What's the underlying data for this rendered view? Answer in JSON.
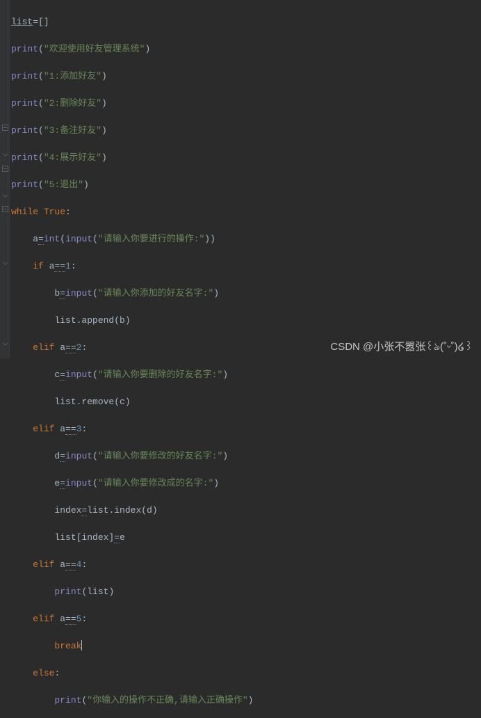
{
  "code": {
    "l1_a": "list",
    "l1_b": "=[]",
    "l2_a": "print",
    "l2_b": "(",
    "l2_c": "\"欢迎使用好友管理系统\"",
    "l2_d": ")",
    "l3_a": "print",
    "l3_b": "(",
    "l3_c": "\"1:添加好友\"",
    "l3_d": ")",
    "l4_a": "print",
    "l4_b": "(",
    "l4_c": "\"2:删除好友\"",
    "l4_d": ")",
    "l5_a": "print",
    "l5_b": "(",
    "l5_c": "\"3:备注好友\"",
    "l5_d": ")",
    "l6_a": "print",
    "l6_b": "(",
    "l6_c": "\"4:展示好友\"",
    "l6_d": ")",
    "l7_a": "print",
    "l7_b": "(",
    "l7_c": "\"5:退出\"",
    "l7_d": ")",
    "l8_a": "while ",
    "l8_b": "True",
    "l8_c": ":",
    "l9_pad": "    ",
    "l9_a": "a",
    "l9_b": "=",
    "l9_c": "int",
    "l9_d": "(",
    "l9_e": "input",
    "l9_f": "(",
    "l9_g": "\"请输入你要进行的操作:\"",
    "l9_h": "))",
    "l10_pad": "    ",
    "l10_a": "if ",
    "l10_b": "a",
    "l10_c": "==",
    "l10_d": "1",
    "l10_e": ":",
    "l11_pad": "        ",
    "l11_a": "b",
    "l11_b": "=",
    "l11_c": "input",
    "l11_d": "(",
    "l11_e": "\"请输入你添加的好友名字:\"",
    "l11_f": ")",
    "l12_pad": "        ",
    "l12_a": "list.append(b)",
    "l13_pad": "    ",
    "l13_a": "elif ",
    "l13_b": "a",
    "l13_c": "==",
    "l13_d": "2",
    "l13_e": ":",
    "l14_pad": "        ",
    "l14_a": "c",
    "l14_b": "=",
    "l14_c": "input",
    "l14_d": "(",
    "l14_e": "\"请输入你要删除的好友名字:\"",
    "l14_f": ")",
    "l15_pad": "        ",
    "l15_a": "list.remove(c)",
    "l16_pad": "    ",
    "l16_a": "elif ",
    "l16_b": "a",
    "l16_c": "==",
    "l16_d": "3",
    "l16_e": ":",
    "l17_pad": "        ",
    "l17_a": "d",
    "l17_b": "=",
    "l17_c": "input",
    "l17_d": "(",
    "l17_e": "\"请输入你要修改的好友名字:\"",
    "l17_f": ")",
    "l18_pad": "        ",
    "l18_a": "e",
    "l18_b": "=",
    "l18_c": "input",
    "l18_d": "(",
    "l18_e": "\"请输入你要修改成的名字:\"",
    "l18_f": ")",
    "l19_pad": "        ",
    "l19_a": "index",
    "l19_b": "=",
    "l19_c": "list.index(d)",
    "l20_pad": "        ",
    "l20_a": "list[index]",
    "l20_b": "=",
    "l20_c": "e",
    "l21_pad": "    ",
    "l21_a": "elif ",
    "l21_b": "a",
    "l21_c": "==",
    "l21_d": "4",
    "l21_e": ":",
    "l22_pad": "        ",
    "l22_a": "print",
    "l22_b": "(list)",
    "l23_pad": "    ",
    "l23_a": "elif ",
    "l23_b": "a",
    "l23_c": "==",
    "l23_d": "5",
    "l23_e": ":",
    "l24_pad": "        ",
    "l24_a": "break",
    "l25_pad": "    ",
    "l25_a": "else",
    "l25_b": ":",
    "l26_pad": "        ",
    "l26_a": "print",
    "l26_b": "(",
    "l26_c": "\"你输入的操作不正确,请输入正确操作\"",
    "l26_d": ")"
  },
  "watermark": "CSDN @小张不嚣张꒰ঌ(˚ᵕ˚)໒꒱"
}
